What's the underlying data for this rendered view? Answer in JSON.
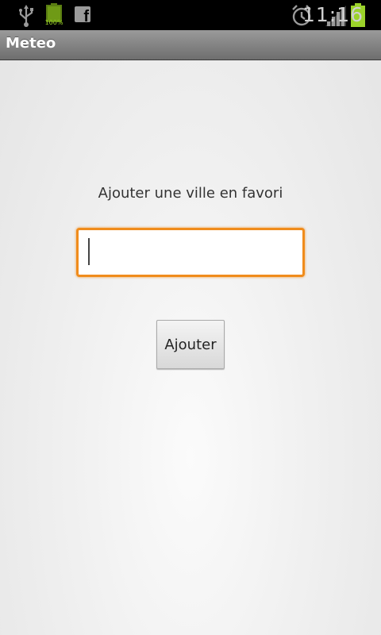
{
  "status_bar": {
    "battery_small_label": "100%",
    "clock": "11:16",
    "icons": [
      "usb-icon",
      "battery-icon",
      "facebook-icon",
      "alarm-icon",
      "signal-icon",
      "battery-icon"
    ],
    "battery_color": "#9bd22a"
  },
  "title_bar": {
    "title": "Meteo"
  },
  "main": {
    "prompt": "Ajouter une ville en favori",
    "city_input": {
      "value": "",
      "placeholder": ""
    },
    "add_button_label": "Ajouter"
  },
  "colors": {
    "input_focus_border": "#f08c1c"
  }
}
